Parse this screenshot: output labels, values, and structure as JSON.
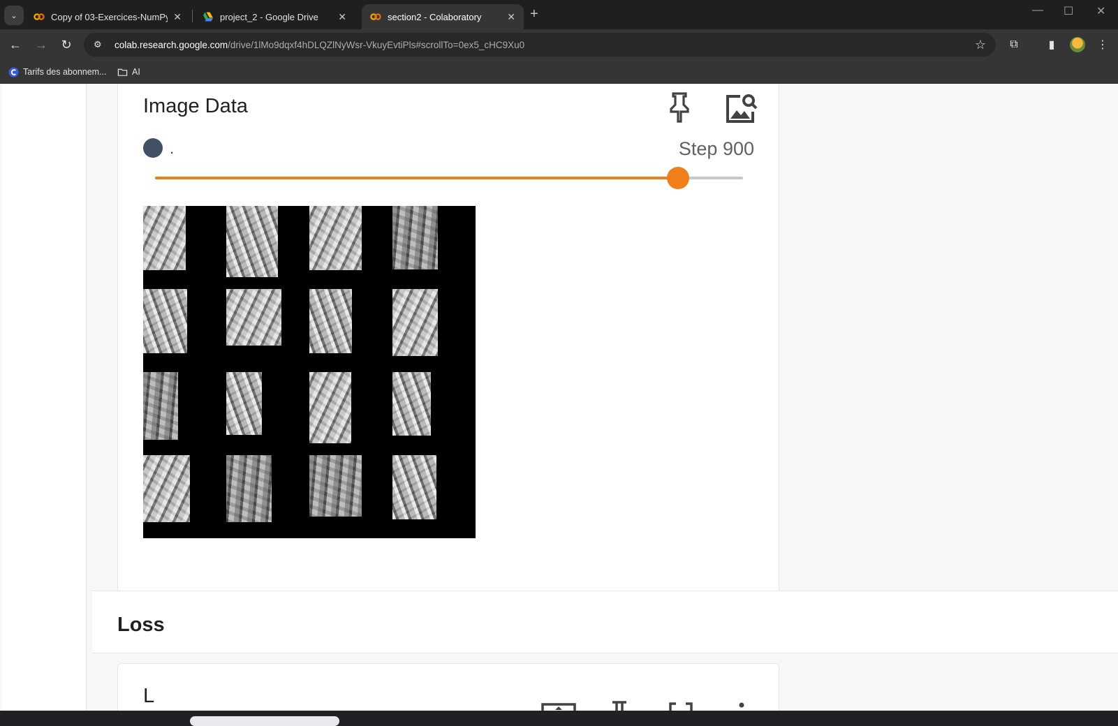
{
  "browser": {
    "tabs": [
      {
        "title": "Copy of 03-Exercices-NumPy.ip",
        "icon": "colab-icon",
        "active": false
      },
      {
        "title": "project_2 - Google Drive",
        "icon": "drive-icon",
        "active": false
      },
      {
        "title": "section2 - Colaboratory",
        "icon": "colab-icon",
        "active": true
      }
    ],
    "tab_close": "✕",
    "new_tab": "+",
    "tab_search": "⌄",
    "window_controls": {
      "minimize": "—",
      "maximize": "☐",
      "close": "✕"
    },
    "nav": {
      "back": "←",
      "forward": "→",
      "reload": "↻"
    },
    "url": {
      "host": "colab.research.google.com",
      "path": "/drive/1lMo9dqxf4hDLQZlNyWsr-VkuyEvtiPls#scrollTo=0ex5_cHC9Xu0"
    },
    "icons": {
      "site_info": "⚙",
      "star": "☆",
      "extensions": "⧉",
      "side_panel": "▮",
      "menu": "⋮"
    },
    "bookmarks": [
      {
        "label": "Tarifs des abonnem...",
        "icon": "c-logo-icon"
      },
      {
        "label": "AI",
        "icon": "folder-icon"
      }
    ]
  },
  "tensorboard": {
    "image_card": {
      "title": "Image Data",
      "run_label": ".",
      "run_color": "#425066",
      "step_label": "Step 900",
      "slider_fraction": 0.89,
      "slider_color": "#ef7f1a",
      "grid_rows": 4,
      "grid_cols": 4
    },
    "section_title": "Loss",
    "next_card_title": "L"
  }
}
